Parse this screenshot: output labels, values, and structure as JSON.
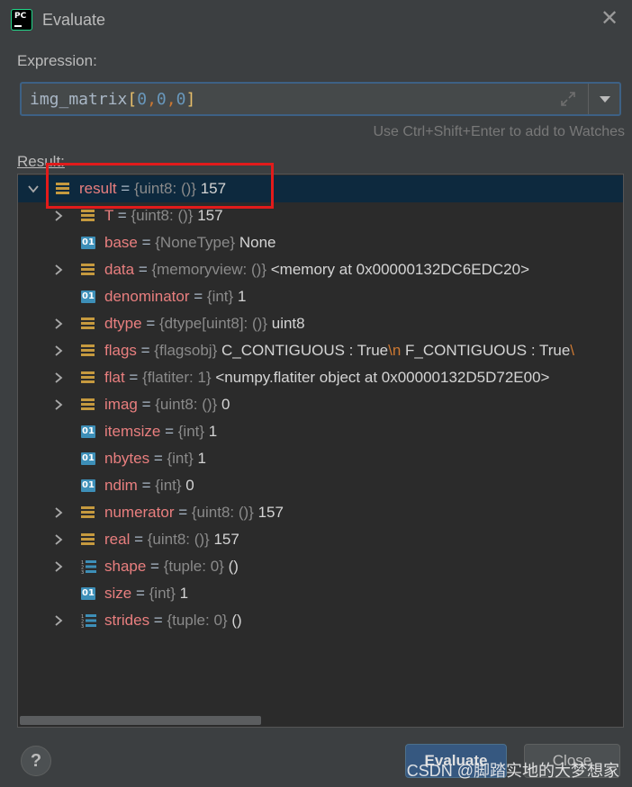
{
  "window": {
    "title": "Evaluate",
    "logo": "PC"
  },
  "expression": {
    "label": "Expression:",
    "value": {
      "name": "img_matrix",
      "open": "[",
      "i0": "0",
      "c1": ",",
      "i1": "0",
      "c2": ",",
      "i2": "0",
      "close": "]"
    },
    "hint": "Use Ctrl+Shift+Enter to add to Watches"
  },
  "result": {
    "label": "Result:",
    "rows": [
      {
        "name": "result",
        "type": "{uint8: ()}",
        "value": "157",
        "expandable": true,
        "expanded": true,
        "icon": "field-icon",
        "indent": 0
      },
      {
        "name": "T",
        "type": "{uint8: ()}",
        "value": "157",
        "expandable": true,
        "icon": "field-icon",
        "indent": 1
      },
      {
        "name": "base",
        "type": "{NoneType}",
        "value": "None",
        "expandable": false,
        "icon": "primitive-icon",
        "indent": 1
      },
      {
        "name": "data",
        "type": "{memoryview: ()}",
        "value": "<memory at 0x00000132DC6EDC20>",
        "expandable": true,
        "icon": "field-icon",
        "indent": 1
      },
      {
        "name": "denominator",
        "type": "{int}",
        "value": "1",
        "expandable": false,
        "icon": "primitive-icon",
        "indent": 1
      },
      {
        "name": "dtype",
        "type": "{dtype[uint8]: ()}",
        "value": "uint8",
        "expandable": true,
        "icon": "field-icon",
        "indent": 1
      },
      {
        "name": "flags",
        "type": "{flagsobj}",
        "value": "C_CONTIGUOUS : True",
        "value_esc": "\\n",
        "value2": "  F_CONTIGUOUS : True",
        "value_esc2": "\\",
        "expandable": true,
        "icon": "field-icon",
        "indent": 1
      },
      {
        "name": "flat",
        "type": "{flatiter: 1}",
        "value": "<numpy.flatiter object at 0x00000132D5D72E00>",
        "expandable": true,
        "icon": "field-icon",
        "indent": 1
      },
      {
        "name": "imag",
        "type": "{uint8: ()}",
        "value": "0",
        "expandable": true,
        "icon": "field-icon",
        "indent": 1
      },
      {
        "name": "itemsize",
        "type": "{int}",
        "value": "1",
        "expandable": false,
        "icon": "primitive-icon",
        "indent": 1
      },
      {
        "name": "nbytes",
        "type": "{int}",
        "value": "1",
        "expandable": false,
        "icon": "primitive-icon",
        "indent": 1
      },
      {
        "name": "ndim",
        "type": "{int}",
        "value": "0",
        "expandable": false,
        "icon": "primitive-icon",
        "indent": 1
      },
      {
        "name": "numerator",
        "type": "{uint8: ()}",
        "value": "157",
        "expandable": true,
        "icon": "field-icon",
        "indent": 1
      },
      {
        "name": "real",
        "type": "{uint8: ()}",
        "value": "157",
        "expandable": true,
        "icon": "field-icon",
        "indent": 1
      },
      {
        "name": "shape",
        "type": "{tuple: 0}",
        "value": "()",
        "expandable": true,
        "icon": "list-icon",
        "indent": 1
      },
      {
        "name": "size",
        "type": "{int}",
        "value": "1",
        "expandable": false,
        "icon": "primitive-icon",
        "indent": 1
      },
      {
        "name": "strides",
        "type": "{tuple: 0}",
        "value": "()",
        "expandable": true,
        "icon": "list-icon",
        "indent": 1
      }
    ]
  },
  "primitive_icon_label": "01",
  "buttons": {
    "help": "?",
    "evaluate": "Evaluate",
    "close": "Close"
  },
  "watermark": "CSDN @脚踏实地的大梦想家",
  "colors": {
    "background": "#3c3f41",
    "tree_bg": "#2b2b2b",
    "selection": "#0d293e",
    "name": "#e97f7f",
    "highlight": "#e21b1b"
  }
}
